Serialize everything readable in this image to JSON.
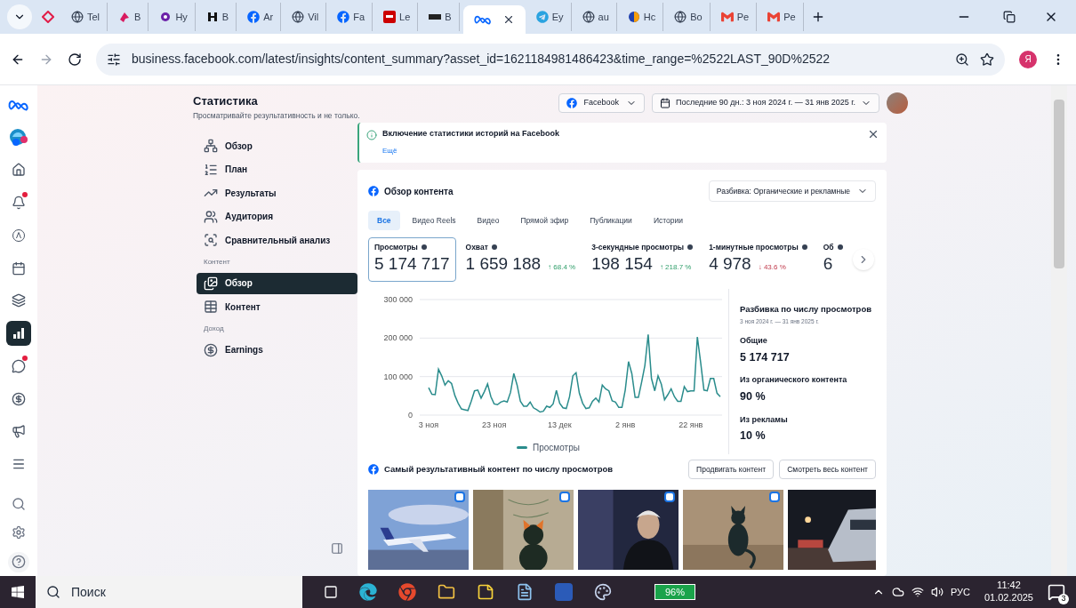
{
  "browser": {
    "tabs": [
      {
        "label": "Tel",
        "kind": "globe",
        "selected": false
      },
      {
        "label": "B",
        "kind": "bird",
        "selected": false
      },
      {
        "label": "Hy",
        "kind": "flower",
        "selected": false
      },
      {
        "label": "B",
        "kind": "h",
        "selected": false
      },
      {
        "label": "Ar",
        "kind": "fb",
        "selected": false
      },
      {
        "label": "Vil",
        "kind": "globe",
        "selected": false
      },
      {
        "label": "Fa",
        "kind": "fb",
        "selected": false
      },
      {
        "label": "Le",
        "kind": "news",
        "selected": false
      },
      {
        "label": "B",
        "kind": "dots",
        "selected": false
      },
      {
        "kind": "meta",
        "selected": true
      },
      {
        "label": "Ey",
        "kind": "telegram",
        "selected": false
      },
      {
        "label": "au",
        "kind": "globe",
        "selected": false
      },
      {
        "label": "Hc",
        "kind": "ball",
        "selected": false
      },
      {
        "label": "Bo",
        "kind": "globe",
        "selected": false
      },
      {
        "label": "Pe",
        "kind": "gmail",
        "selected": false
      },
      {
        "label": "Pe",
        "kind": "gmail",
        "selected": false
      }
    ],
    "address": "business.facebook.com/latest/insights/content_summary?asset_id=1621184981486423&time_range=%2522LAST_90D%2522",
    "profile": "Я"
  },
  "rail": [
    {
      "kind": "meta",
      "selected": false,
      "badge": false
    },
    {
      "kind": "account",
      "selected": false,
      "badge": false
    },
    {
      "kind": "home",
      "selected": false,
      "badge": false
    },
    {
      "kind": "bell",
      "selected": false,
      "badge": true
    },
    {
      "kind": "ads",
      "selected": false,
      "badge": false
    },
    {
      "kind": "calendar",
      "selected": false,
      "badge": false
    },
    {
      "kind": "layers",
      "selected": false,
      "badge": false
    },
    {
      "kind": "chart",
      "selected": true,
      "badge": false
    },
    {
      "kind": "chat",
      "selected": false,
      "badge": true
    },
    {
      "kind": "dollar",
      "selected": false,
      "badge": false
    },
    {
      "kind": "megaphone",
      "selected": false,
      "badge": false
    },
    {
      "kind": "menu",
      "selected": false,
      "badge": false
    }
  ],
  "rail_bottom": [
    {
      "kind": "search"
    },
    {
      "kind": "settings"
    },
    {
      "kind": "help"
    }
  ],
  "header": {
    "title": "Статистика",
    "subtitle": "Просматривайте результативность и не только.",
    "platform": "Facebook",
    "date_range": "Последние 90 дн.: 3 ноя 2024 г. — 31 янв 2025 г."
  },
  "nav": [
    {
      "items": [
        {
          "label": "Обзор",
          "kind": "network",
          "selected": false
        },
        {
          "label": "План",
          "kind": "list",
          "selected": false
        },
        {
          "label": "Результаты",
          "kind": "trend",
          "selected": false
        },
        {
          "label": "Аудитория",
          "kind": "users",
          "selected": false
        },
        {
          "label": "Сравнительный анализ",
          "kind": "compare",
          "selected": false
        }
      ]
    },
    {
      "heading": "Контент",
      "items": [
        {
          "label": "Обзор",
          "kind": "images",
          "selected": true
        },
        {
          "label": "Контент",
          "kind": "table",
          "selected": false
        }
      ]
    },
    {
      "heading": "Доход",
      "items": [
        {
          "label": "Earnings",
          "kind": "dollar",
          "selected": false
        }
      ]
    }
  ],
  "notice": {
    "title": "Включение статистики историй на Facebook",
    "link": "Ещё"
  },
  "overview": {
    "title": "Обзор контента",
    "breakdown": "Разбивка: Органические и рекламные",
    "tabs": [
      {
        "label": "Все",
        "selected": true
      },
      {
        "label": "Видео Reels",
        "selected": false
      },
      {
        "label": "Видео",
        "selected": false
      },
      {
        "label": "Прямой эфир",
        "selected": false
      },
      {
        "label": "Публикации",
        "selected": false
      },
      {
        "label": "Истории",
        "selected": false
      }
    ],
    "metrics": [
      {
        "label": "Просмотры",
        "value": "5 174 717",
        "selected": true
      },
      {
        "label": "Охват",
        "value": "1 659 188",
        "change": "↑ 68.4 %",
        "kind": "increase",
        "selected": false
      },
      {
        "label": "3-секундные просмотры",
        "value": "198 154",
        "change": "↑ 218.7 %",
        "kind": "increase",
        "selected": false
      },
      {
        "label": "1-минутные просмотры",
        "value": "4 978",
        "change": "↓ 43.6 %",
        "kind": "decrease",
        "selected": false
      },
      {
        "label": "Об",
        "value": "6",
        "selected": false
      }
    ],
    "chart_data": {
      "type": "line",
      "categories": [
        "3 ноя",
        null,
        null,
        null,
        null,
        null,
        null,
        null,
        null,
        null,
        null,
        null,
        null,
        null,
        null,
        null,
        null,
        null,
        null,
        null,
        "23 ноя",
        null,
        null,
        null,
        null,
        null,
        null,
        null,
        null,
        null,
        null,
        null,
        null,
        null,
        null,
        null,
        null,
        null,
        null,
        null,
        "13 дек",
        null,
        null,
        null,
        null,
        null,
        null,
        null,
        null,
        null,
        null,
        null,
        null,
        null,
        null,
        null,
        null,
        null,
        null,
        null,
        "2 янв",
        null,
        null,
        null,
        null,
        null,
        null,
        null,
        null,
        null,
        null,
        null,
        null,
        null,
        null,
        null,
        null,
        null,
        null,
        null,
        "22 янв",
        null,
        null,
        null,
        null,
        null,
        null,
        null,
        null,
        null
      ],
      "yticks": [
        {
          "value": 0,
          "label": "0"
        },
        {
          "value": 100000,
          "label": "100 000"
        },
        {
          "value": 200000,
          "label": "200 000"
        },
        {
          "value": 300000,
          "label": "300 000"
        }
      ],
      "ylim": [
        0,
        300000
      ],
      "series": [
        {
          "name": "Просмотры",
          "color": "#2a8c8c",
          "values": [
            71000,
            54000,
            53000,
            119000,
            102000,
            78000,
            89000,
            82000,
            51000,
            31000,
            16000,
            14000,
            12000,
            36000,
            63000,
            65000,
            44000,
            61000,
            81000,
            48000,
            29000,
            27000,
            34000,
            37000,
            34000,
            59000,
            108000,
            78000,
            36000,
            23000,
            23000,
            34000,
            19000,
            14000,
            8000,
            10000,
            23000,
            20000,
            29000,
            64000,
            31000,
            19000,
            17000,
            48000,
            102000,
            110000,
            57000,
            31000,
            17000,
            19000,
            36000,
            44000,
            34000,
            78000,
            68000,
            63000,
            37000,
            34000,
            20000,
            20000,
            65000,
            139000,
            108000,
            46000,
            46000,
            86000,
            129000,
            209000,
            95000,
            63000,
            102000,
            80000,
            40000,
            53000,
            68000,
            48000,
            36000,
            36000,
            74000,
            61000,
            63000,
            63000,
            203000,
            137000,
            65000,
            63000,
            95000,
            95000,
            57000,
            48000
          ]
        }
      ]
    },
    "summary": {
      "title": "Разбивка по числу просмотров",
      "period": "3 ноя 2024 г. — 31 янв 2025 г.",
      "rows": [
        {
          "label": "Общие",
          "value": "5 174 717"
        },
        {
          "label": "Из органического контента",
          "value": "90 %"
        },
        {
          "label": "Из рекламы",
          "value": "10 %"
        }
      ]
    }
  },
  "top_content": {
    "title": "Самый результативный контент по числу просмотров",
    "buttons": [
      "Продвигать контент",
      "Смотреть весь контент"
    ],
    "items": [
      {
        "kind": "plane"
      },
      {
        "kind": "cat_wall"
      },
      {
        "kind": "person"
      },
      {
        "kind": "cat_shadow"
      },
      {
        "kind": "train"
      }
    ]
  },
  "taskbar": {
    "search": "Поиск",
    "battery": "96%",
    "language": "РУС",
    "time": "11:42",
    "date": "01.02.2025",
    "notifications": "3"
  }
}
